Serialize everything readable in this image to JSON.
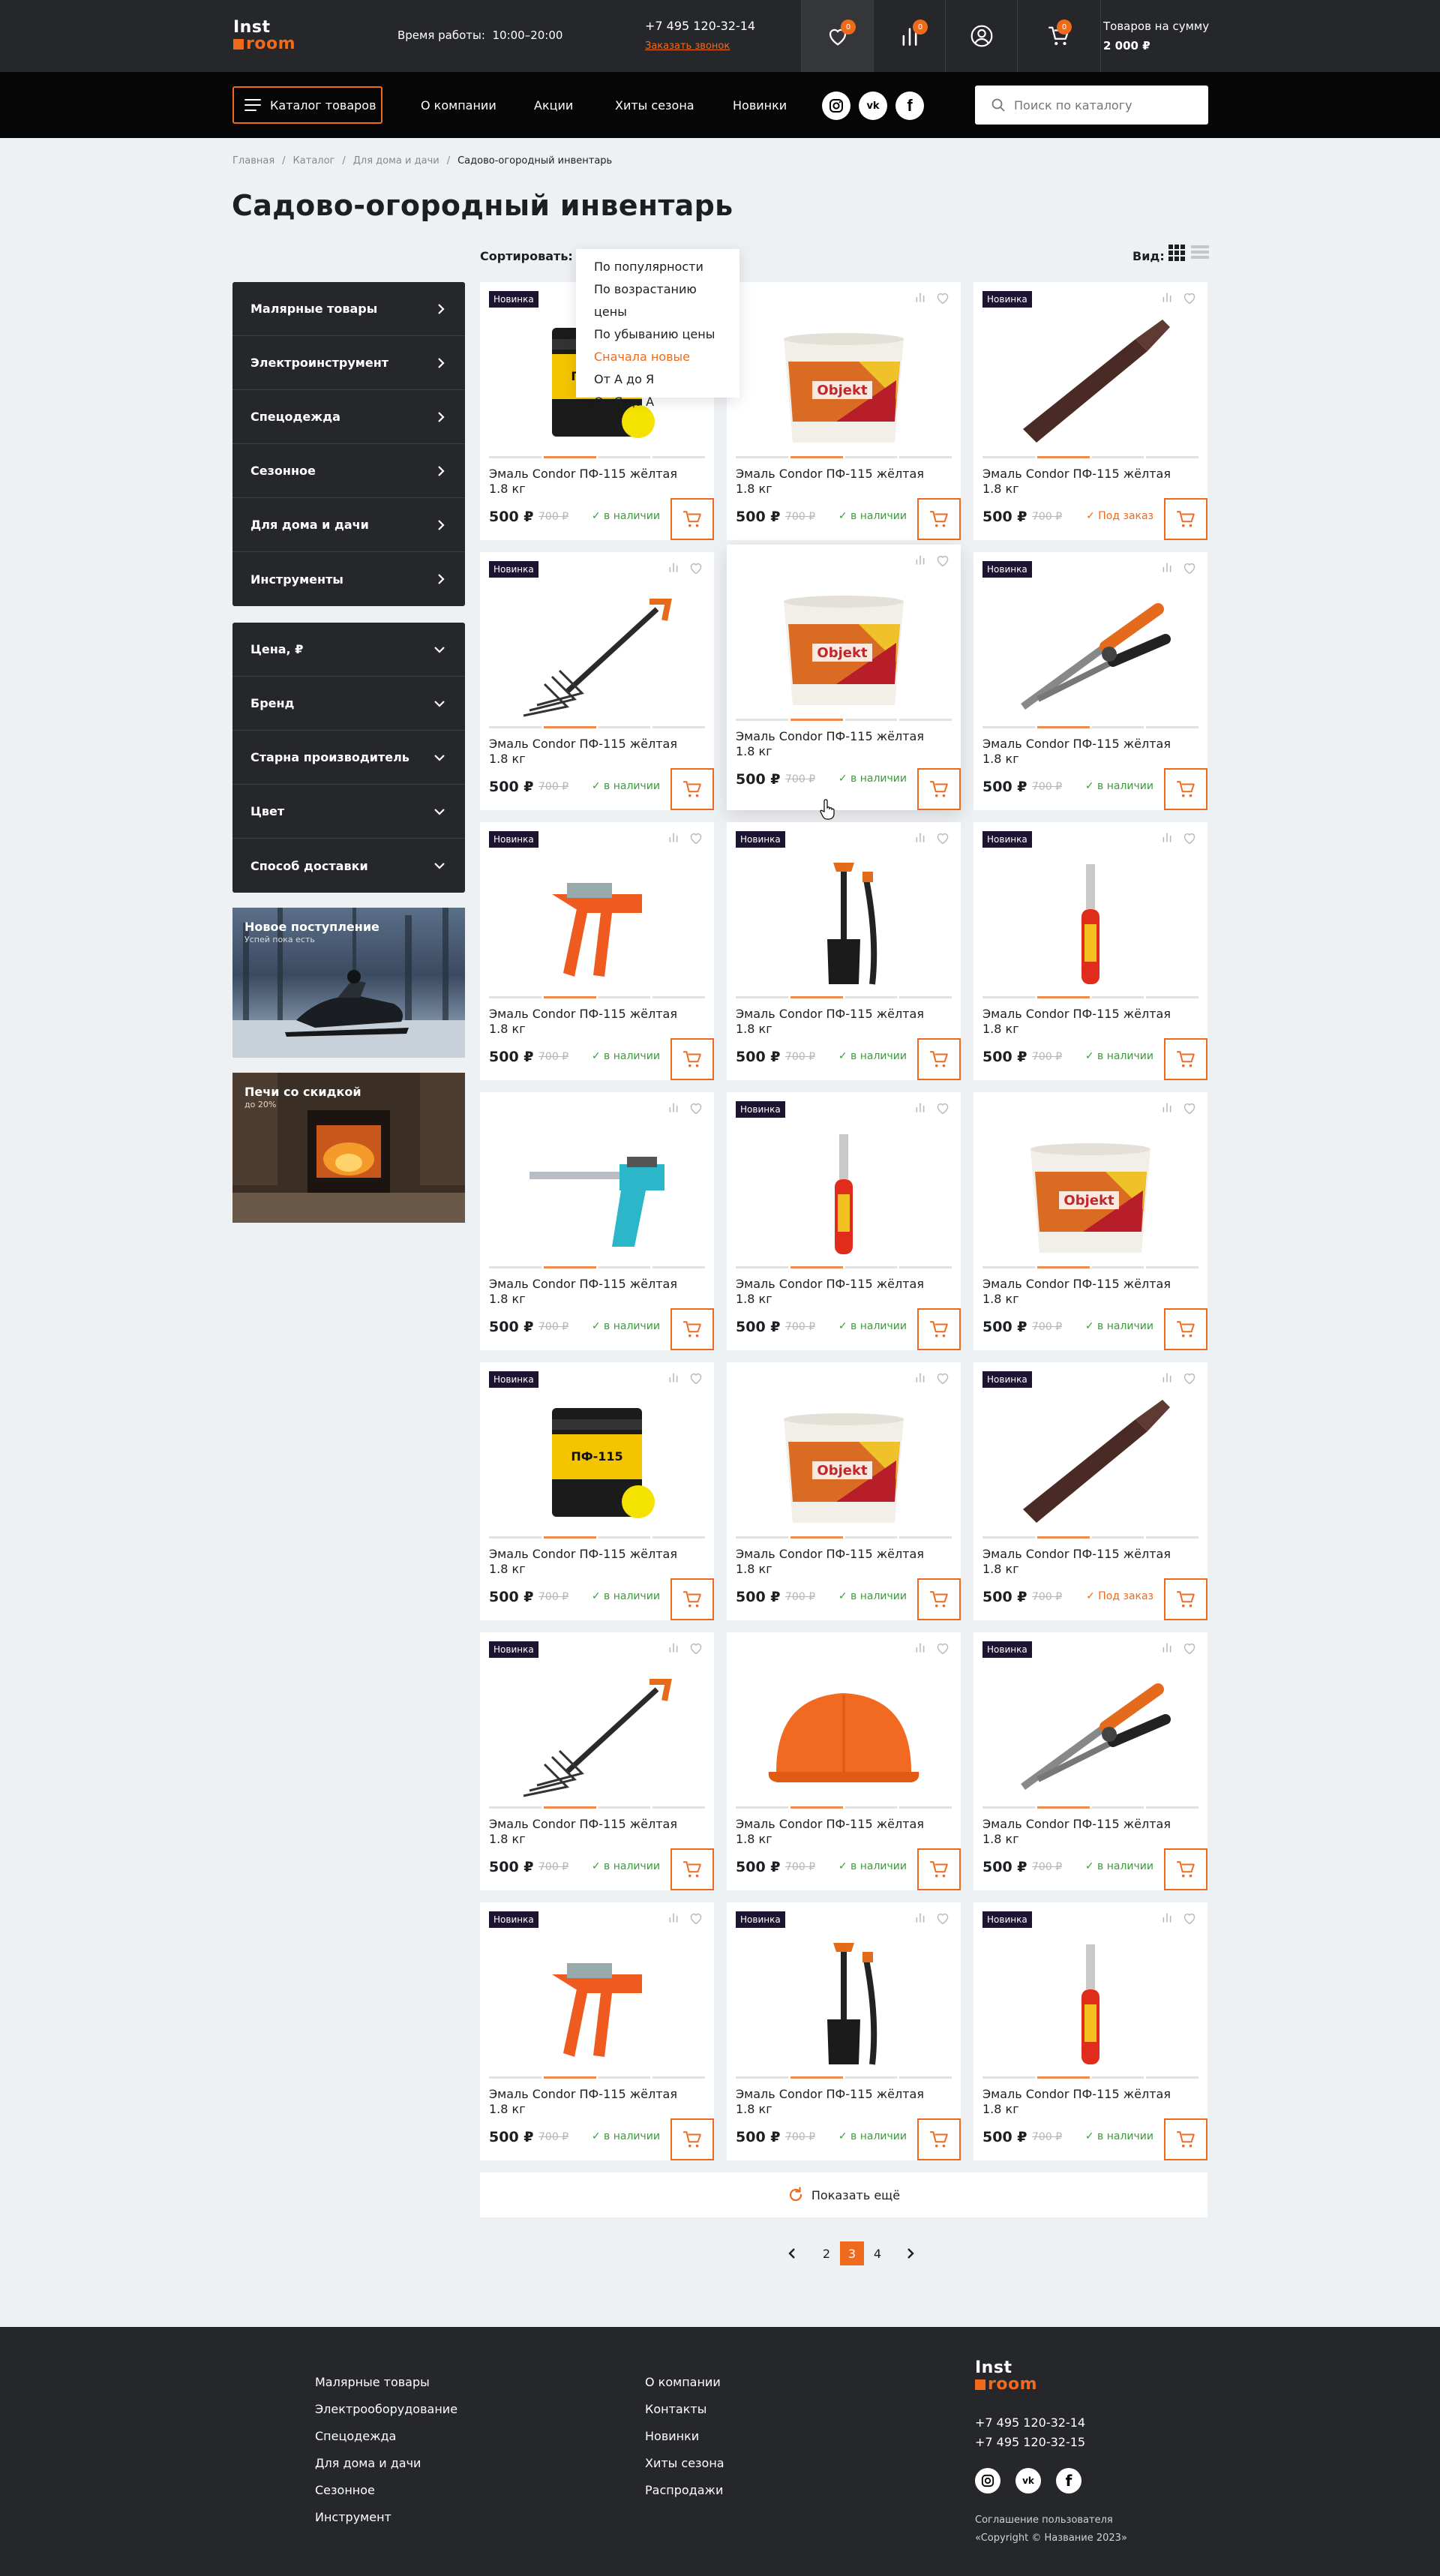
{
  "header": {
    "logo_top": "Inst",
    "logo_bottom": "room",
    "hours_label": "Время работы:",
    "hours_value": "10:00–20:00",
    "phone": "+7 495 120-32-14",
    "callback": "Заказать звонок",
    "favorites_count": "0",
    "compare_count": "0",
    "cart_count": "0",
    "cart_label": "Товаров на сумму",
    "cart_sum": "2 000 ₽"
  },
  "nav": {
    "catalog_button": "Каталог товаров",
    "links": [
      "О компании",
      "Акции",
      "Хиты сезона",
      "Новинки"
    ],
    "search_placeholder": "Поиск по каталогу"
  },
  "breadcrumb": [
    "Главная",
    "Каталог",
    "Для дома и дачи",
    "Садово-огородный инвентарь"
  ],
  "page_title": "Садово-огородный инвентарь",
  "sort": {
    "label": "Сортировать:",
    "options": [
      "По популярности",
      "По возрастанию цены",
      "По убыванию цены",
      "Сначала новые",
      "От А до Я",
      "От Я до А"
    ],
    "selected": "Сначала новые"
  },
  "view_label": "Вид:",
  "sidebar": {
    "categories": [
      "Малярные товары",
      "Электроинструмент",
      "Спецодежда",
      "Сезонное",
      "Для дома и дачи",
      "Инструменты"
    ],
    "filters": [
      "Цена, ₽",
      "Бренд",
      "Старна производитель",
      "Цвет",
      "Способ доставки"
    ]
  },
  "promos": [
    {
      "title": "Новое поступление",
      "subtitle": "Успей пока есть"
    },
    {
      "title": "Печи со скидкой",
      "subtitle": "до 20%"
    }
  ],
  "product_common": {
    "name": "Эмаль Condor ПФ-115 жёлтая",
    "weight": "1.8 кг",
    "price": "500 ₽",
    "old_price": "700 ₽",
    "new_badge": "Новинка"
  },
  "products": [
    {
      "img": "can",
      "isnew": true,
      "status": "✓ в наличии",
      "instock": true
    },
    {
      "img": "bucket",
      "isnew": false,
      "status": "✓ в наличии",
      "instock": true
    },
    {
      "img": "bit",
      "isnew": true,
      "status": "✓ Под заказ",
      "instock": false
    },
    {
      "img": "fork",
      "isnew": true,
      "status": "✓ в наличии",
      "instock": true
    },
    {
      "img": "bucket",
      "isnew": false,
      "status": "✓ в наличии",
      "instock": true
    },
    {
      "img": "snips",
      "isnew": true,
      "status": "✓ в наличии",
      "instock": true
    },
    {
      "img": "stapler",
      "isnew": true,
      "status": "✓ в наличии",
      "instock": true
    },
    {
      "img": "shovel",
      "isnew": true,
      "status": "✓ в наличии",
      "instock": true
    },
    {
      "img": "screwdriver",
      "isnew": true,
      "status": "✓ в наличии",
      "instock": true
    },
    {
      "img": "gun",
      "isnew": false,
      "status": "✓ в наличии",
      "instock": true
    },
    {
      "img": "screwdriver",
      "isnew": true,
      "status": "✓ в наличии",
      "instock": true
    },
    {
      "img": "bucket",
      "isnew": false,
      "status": "✓ в наличии",
      "instock": true
    },
    {
      "img": "can",
      "isnew": true,
      "status": "✓ в наличии",
      "instock": true
    },
    {
      "img": "bucket",
      "isnew": false,
      "status": "✓ в наличии",
      "instock": true
    },
    {
      "img": "bit",
      "isnew": true,
      "status": "✓ Под заказ",
      "instock": false
    },
    {
      "img": "fork",
      "isnew": true,
      "status": "✓ в наличии",
      "instock": true
    },
    {
      "img": "helmet",
      "isnew": false,
      "status": "✓ в наличии",
      "instock": true
    },
    {
      "img": "snips",
      "isnew": true,
      "status": "✓ в наличии",
      "instock": true
    },
    {
      "img": "stapler",
      "isnew": true,
      "status": "✓ в наличии",
      "instock": true
    },
    {
      "img": "shovel",
      "isnew": true,
      "status": "✓ в наличии",
      "instock": true
    },
    {
      "img": "screwdriver",
      "isnew": true,
      "status": "✓ в наличии",
      "instock": true
    }
  ],
  "show_more": "Показать ещё",
  "pagination": {
    "pages": [
      "2",
      "3",
      "4"
    ],
    "current": "3"
  },
  "footer": {
    "col1": [
      "Малярные товары",
      "Электрооборудование",
      "Спецодежда",
      "Для дома и дачи",
      "Сезонное",
      "Инструмент"
    ],
    "col2": [
      "О компании",
      "Контакты",
      "Новинки",
      "Хиты сезона",
      "Распродажи"
    ],
    "phones": [
      "+7 495 120-32-14",
      "+7 495 120-32-15"
    ],
    "agreement": "Соглашение пользователя",
    "copyright": "«Copyright © Название 2023»"
  },
  "colors": {
    "accent": "#ef6a1c",
    "dark": "#25272a",
    "black": "#060606",
    "bg": "#eef1f4",
    "instock": "#3d9a3d"
  }
}
